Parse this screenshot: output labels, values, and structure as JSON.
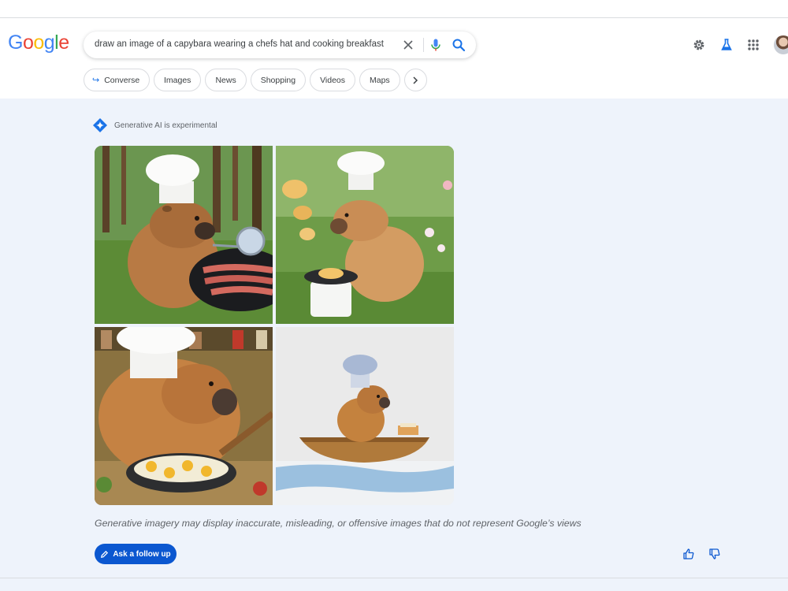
{
  "logo": {
    "letters": [
      "G",
      "o",
      "o",
      "g",
      "l",
      "e"
    ]
  },
  "search": {
    "query": "draw an image of a capybara wearing a chefs hat and cooking breakfast"
  },
  "header_icons": [
    "settings-icon",
    "labs-flask-icon",
    "apps-grid-icon",
    "avatar"
  ],
  "chips": [
    {
      "label": "Converse",
      "icon": "converse-arrow-icon"
    },
    {
      "label": "Images"
    },
    {
      "label": "News"
    },
    {
      "label": "Shopping"
    },
    {
      "label": "Videos"
    },
    {
      "label": "Maps"
    }
  ],
  "ai": {
    "label": "Generative AI is experimental",
    "images": [
      {
        "scene": "capybara-chef-grilling-bacon-in-forest"
      },
      {
        "scene": "capybara-chef-flipping-pancakes-in-garden"
      },
      {
        "scene": "capybara-chef-frying-eggs-in-kitchen"
      },
      {
        "scene": "capybara-chef-in-boat-watercolor"
      }
    ],
    "disclaimer": "Generative imagery may display inaccurate, misleading, or offensive images that do not represent Google’s views",
    "follow_up_label": "Ask a follow up"
  },
  "feedback": [
    "thumbs-up-icon",
    "thumbs-down-icon"
  ],
  "colors": {
    "google_blue": "#4285f4",
    "google_red": "#ea4335",
    "google_yellow": "#fbbc05",
    "google_green": "#34a853",
    "primary_button": "#0b57d0",
    "panel_bg": "#eef3fb"
  }
}
